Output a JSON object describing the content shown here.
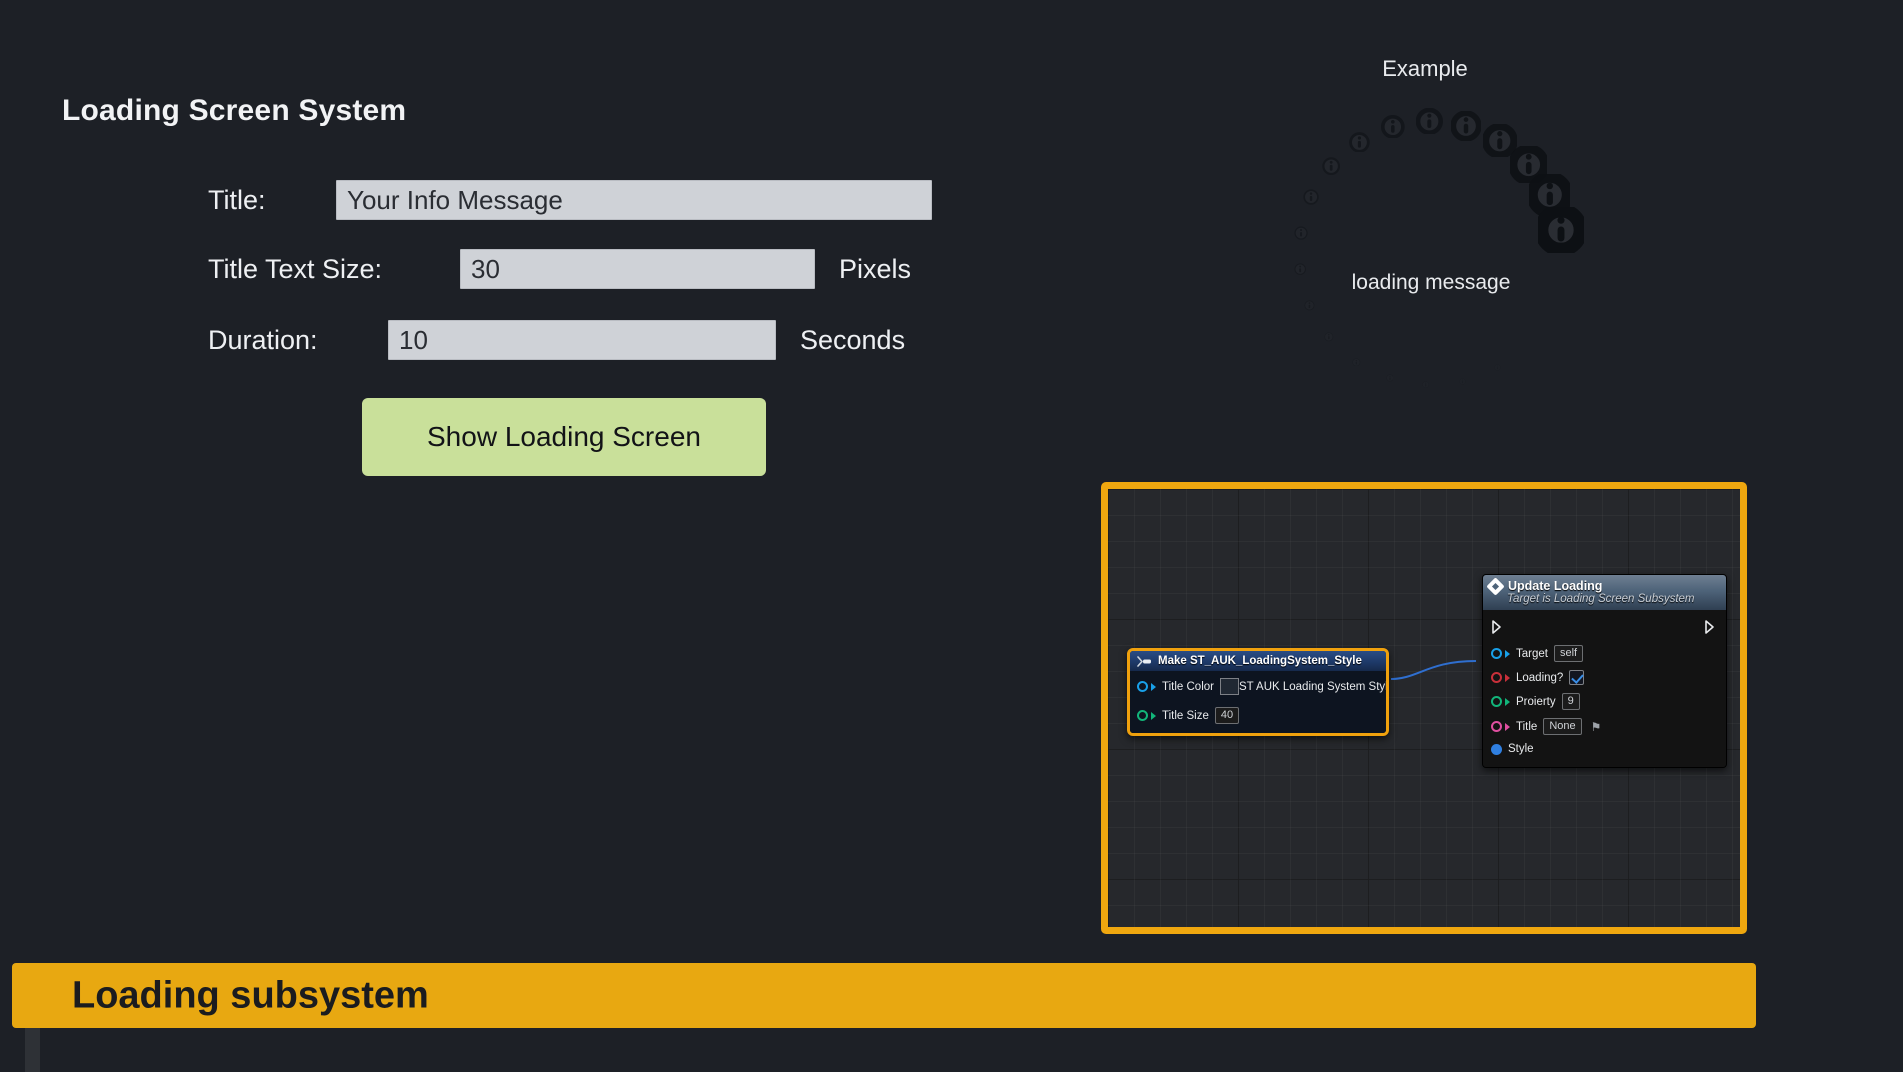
{
  "app": {
    "background_color": "#1d2026",
    "accent_color": "#e8a811",
    "button_color": "#c9e09a"
  },
  "page_title": "Loading Screen System",
  "form": {
    "rows": [
      {
        "label": "Title:",
        "value": "Your Info Message",
        "placeholder": "Your Info Message",
        "unit": ""
      },
      {
        "label": "Title Text Size:",
        "value": "30",
        "placeholder": "30",
        "unit": "Pixels"
      },
      {
        "label": "Duration:",
        "value": "10",
        "placeholder": "10",
        "unit": "Seconds"
      }
    ],
    "submit_label": "Show Loading Screen"
  },
  "example": {
    "heading": "Example",
    "loading_message": "loading message",
    "icon_name": "info-icon",
    "dot_count": 19
  },
  "graph": {
    "border_color": "#efa70f",
    "update_node": {
      "title": "Update Loading",
      "subtitle": "Target is Loading Screen Subsystem",
      "icon": "diamond-icon",
      "exec_in": "exec-in-pin",
      "exec_out": "exec-out-pin",
      "pins": [
        {
          "label": "Target",
          "value": "self",
          "color": "#19a0e8",
          "type": "object"
        },
        {
          "label": "Loading?",
          "value": "",
          "color": "#c9303a",
          "type": "boolean"
        },
        {
          "label": "Proierty",
          "value": "9",
          "color": "#12b57a",
          "type": "number"
        },
        {
          "label": "Title",
          "value": "None",
          "color": "#e04fa0",
          "type": "text"
        },
        {
          "label": "Style",
          "value": "",
          "color": "#2f7fe0",
          "type": "struct"
        }
      ]
    },
    "make_node": {
      "title": "Make ST_AUK_LoadingSystem_Style",
      "border_color": "#f0a10d",
      "inputs": [
        {
          "label": "Title Color",
          "value": "",
          "color": "#19a0e8"
        },
        {
          "label": "Title Size",
          "value": "40",
          "color": "#12b57a"
        }
      ],
      "output": {
        "label": "ST AUK Loading System Style",
        "color": "#2f7fe0"
      }
    }
  },
  "bottom_banner": {
    "text": "Loading subsystem"
  }
}
